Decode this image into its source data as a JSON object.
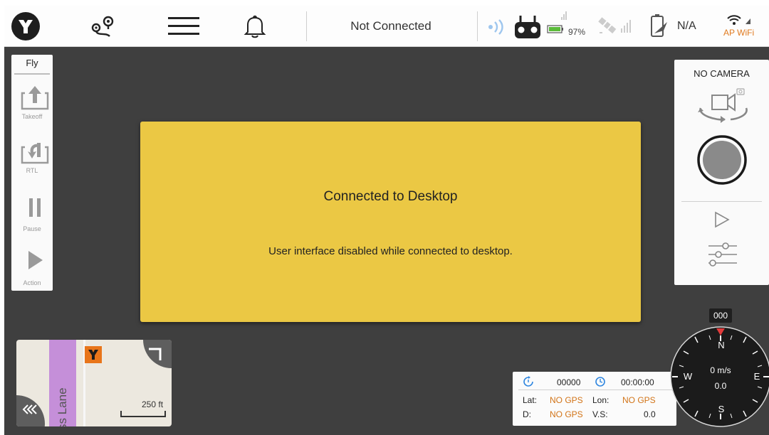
{
  "topbar": {
    "connection_status": "Not Connected",
    "battery_percent": "97%",
    "link_value": "N/A",
    "wifi_label": "AP WiFi",
    "icons": [
      "app-logo-icon",
      "mission-route-icon",
      "hamburger-menu-icon",
      "notification-bell-icon",
      "remote-signal-icon",
      "controller-icon",
      "battery-icon",
      "satellite-gps-icon",
      "drone-battery-icon",
      "wifi-icon"
    ],
    "colors": {
      "battery": "#5bbb3a",
      "wifi_label": "#e07a1f"
    }
  },
  "fly_panel": {
    "title": "Fly",
    "buttons": [
      {
        "label": "Takeoff",
        "icon": "takeoff-icon"
      },
      {
        "label": "RTL",
        "icon": "return-to-launch-icon"
      },
      {
        "label": "Pause",
        "icon": "pause-icon"
      },
      {
        "label": "Action",
        "icon": "play-action-icon"
      }
    ]
  },
  "modal": {
    "title": "Connected to Desktop",
    "message": "User interface disabled while connected to desktop.",
    "background": "#ebc844"
  },
  "camera_panel": {
    "title": "NO CAMERA",
    "icons": [
      "switch-camera-icon",
      "record-button-icon",
      "playback-icon",
      "camera-settings-icon"
    ]
  },
  "minimap": {
    "street_label": "ss Lane",
    "scale_label": "250 ft",
    "icons": [
      "map-marker-icon",
      "expand-map-icon",
      "collapse-panel-icon"
    ]
  },
  "telemetry": {
    "flight_count": "00000",
    "flight_time": "00:00:00",
    "lat_label": "Lat:",
    "lat_value": "NO GPS",
    "lon_label": "Lon:",
    "lon_value": "NO GPS",
    "dist_label": "D:",
    "dist_value": "NO GPS",
    "vs_label": "V.S:",
    "vs_value": "0.0",
    "colors": {
      "accent": "#2f86e0",
      "warn": "#d27418"
    }
  },
  "compass": {
    "heading": "000",
    "north": "N",
    "east": "E",
    "south": "S",
    "west": "W",
    "speed": "0 m/s",
    "altitude": "0.0"
  }
}
